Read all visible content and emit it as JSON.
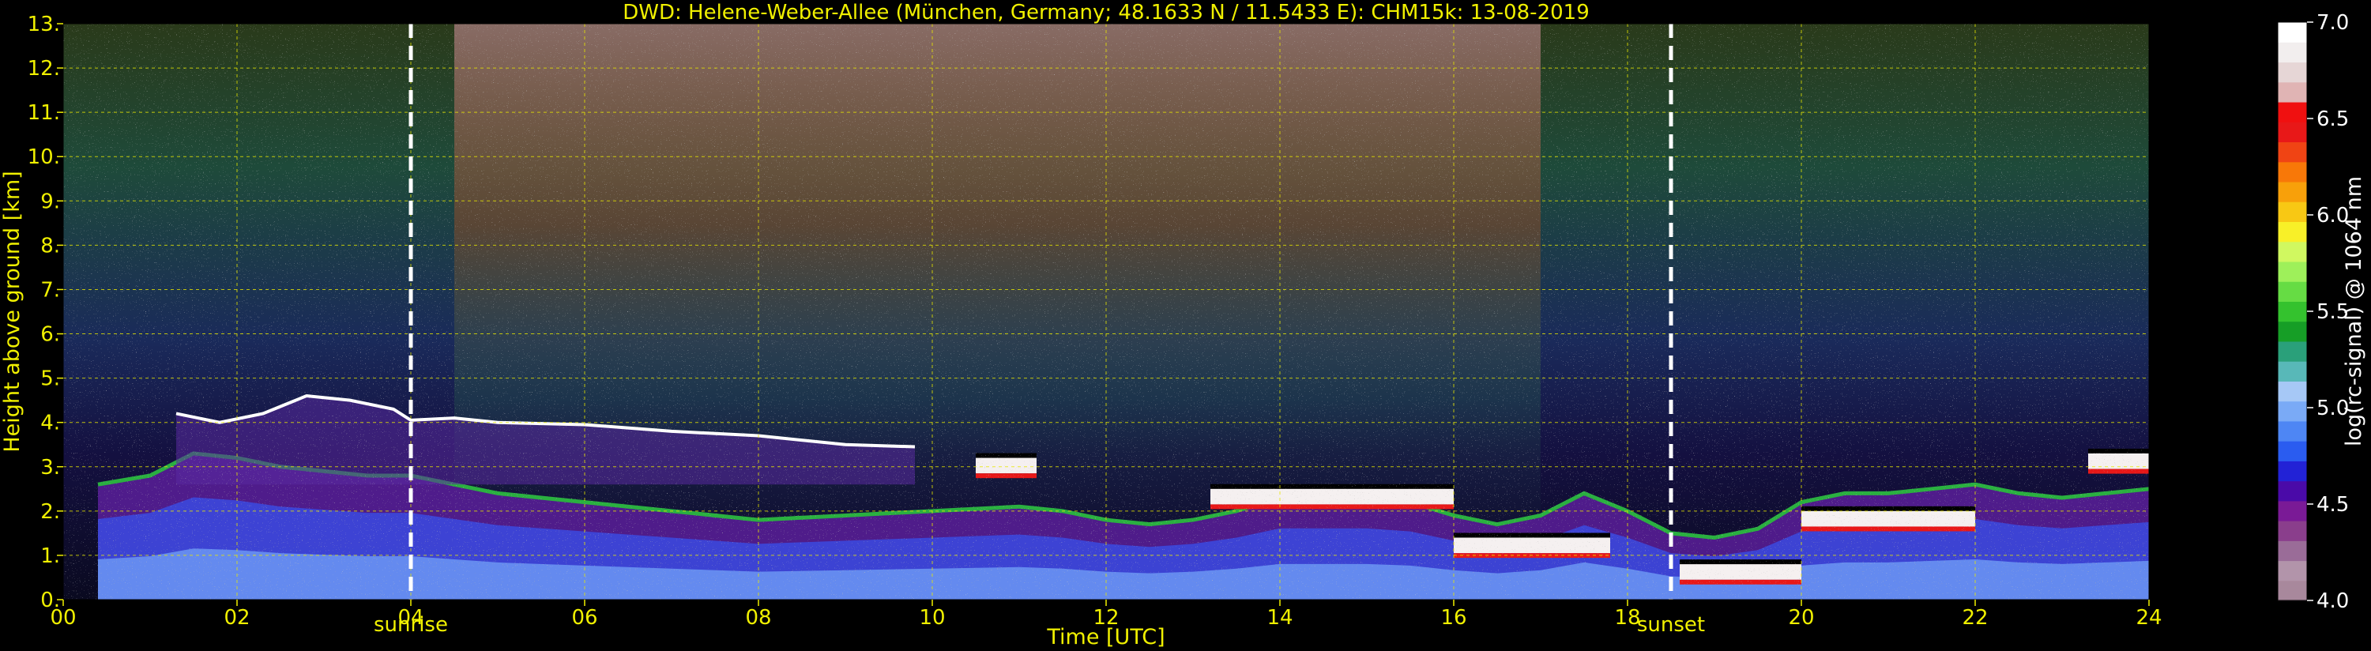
{
  "chart_data": {
    "type": "heatmap",
    "title": "DWD: Helene-Weber-Allee (München, Germany; 48.1633 N / 11.5433 E):    CHM15k: 13-08-2019",
    "xlabel": "Time [UTC]",
    "ylabel": "Height above ground [km]",
    "xlim": [
      0,
      24
    ],
    "ylim": [
      0,
      13
    ],
    "x_ticks": [
      "00",
      "02",
      "04",
      "06",
      "08",
      "10",
      "12",
      "14",
      "16",
      "18",
      "20",
      "22",
      "24"
    ],
    "x_tick_values": [
      0,
      2,
      4,
      6,
      8,
      10,
      12,
      14,
      16,
      18,
      20,
      22,
      24
    ],
    "y_ticks": [
      "0.",
      "1.",
      "2.",
      "3.",
      "4.",
      "5.",
      "6.",
      "7.",
      "8.",
      "9.",
      "10.",
      "11.",
      "12.",
      "13."
    ],
    "y_tick_values": [
      0,
      1,
      2,
      3,
      4,
      5,
      6,
      7,
      8,
      9,
      10,
      11,
      12,
      13
    ],
    "grid": true,
    "annotations": [
      {
        "label": "sunrise",
        "x": 4.0
      },
      {
        "label": "sunset",
        "x": 18.5
      }
    ],
    "colorbar": {
      "label": "log(rc-signal) @ 1064 nm",
      "range": [
        4.0,
        7.0
      ],
      "ticks": [
        "4.0",
        "4.5",
        "5.0",
        "5.5",
        "6.0",
        "6.5",
        "7.0"
      ],
      "tick_values": [
        4.0,
        4.5,
        5.0,
        5.5,
        6.0,
        6.5,
        7.0
      ],
      "colors": [
        "#a8889c",
        "#b294aa",
        "#9a6c98",
        "#8a3e8c",
        "#7a1a96",
        "#4a0aa8",
        "#2222d6",
        "#2a5cf0",
        "#4e86f4",
        "#7aaaf6",
        "#a6c8f6",
        "#58b8b8",
        "#2aa07a",
        "#169e26",
        "#34c22e",
        "#66dc44",
        "#9ef05a",
        "#d0f860",
        "#f8f028",
        "#f8c814",
        "#f8a00a",
        "#f87808",
        "#f04414",
        "#e81818",
        "#f01010",
        "#e0b4b4",
        "#e6d6d6",
        "#f2eeee",
        "#ffffff"
      ]
    },
    "boundary_layer_top_km": {
      "x": [
        0.4,
        1.0,
        1.5,
        2.0,
        2.5,
        3.0,
        3.5,
        4.0,
        4.5,
        5.0,
        6.0,
        7.0,
        8.0,
        9.0,
        10.0,
        11.0,
        11.5,
        12.0,
        12.5,
        13.0,
        13.5,
        14.0,
        14.5,
        15.0,
        15.5,
        16.0,
        16.5,
        17.0,
        17.5,
        18.0,
        18.5,
        19.0,
        19.5,
        20.0,
        20.5,
        21.0,
        21.5,
        22.0,
        22.5,
        23.0,
        23.5,
        24.0
      ],
      "y": [
        2.6,
        2.8,
        3.3,
        3.2,
        3.0,
        2.9,
        2.8,
        2.8,
        2.6,
        2.4,
        2.2,
        2.0,
        1.8,
        1.9,
        2.0,
        2.1,
        2.0,
        1.8,
        1.7,
        1.8,
        2.0,
        2.3,
        2.3,
        2.3,
        2.2,
        1.9,
        1.7,
        1.9,
        2.4,
        2.0,
        1.5,
        1.4,
        1.6,
        2.2,
        2.4,
        2.4,
        2.5,
        2.6,
        2.4,
        2.3,
        2.4,
        2.5
      ]
    },
    "residual_layer_top_km": {
      "x": [
        1.3,
        1.8,
        2.3,
        2.8,
        3.3,
        3.8,
        4.0,
        4.5,
        5.0,
        6.0,
        7.0,
        8.0,
        9.0,
        9.8
      ],
      "y": [
        4.2,
        4.0,
        4.2,
        4.6,
        4.5,
        4.3,
        4.05,
        4.1,
        4.0,
        3.95,
        3.8,
        3.7,
        3.5,
        3.45
      ]
    },
    "cloud_layers": [
      {
        "x_start": 10.5,
        "x_end": 11.2,
        "y_km": 3.2
      },
      {
        "x_start": 13.2,
        "x_end": 16.0,
        "y_km": 2.5
      },
      {
        "x_start": 16.0,
        "x_end": 17.8,
        "y_km": 1.4
      },
      {
        "x_start": 18.6,
        "x_end": 20.0,
        "y_km": 0.8
      },
      {
        "x_start": 20.0,
        "x_end": 22.0,
        "y_km": 2.0
      },
      {
        "x_start": 23.3,
        "x_end": 24.0,
        "y_km": 3.3
      }
    ]
  }
}
